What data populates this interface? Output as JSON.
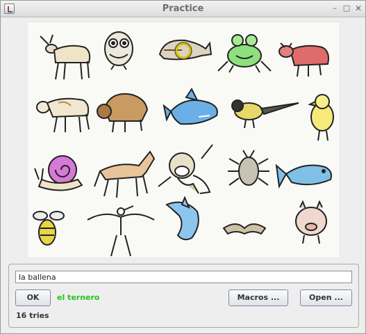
{
  "window": {
    "title": "Practice",
    "controls": {
      "minimize": "–",
      "maximize": "□",
      "close": "✕"
    }
  },
  "picture": {
    "items": [
      "goat",
      "owl",
      "whale",
      "frog",
      "bull",
      "calf",
      "bison",
      "shark",
      "bird",
      "chick",
      "snail",
      "horse",
      "monkey",
      "bug",
      "fish",
      "bee",
      "stork",
      "dolphin",
      "bat",
      "pig"
    ],
    "highlighted": "whale",
    "highlight_color": "#d4c400"
  },
  "answer": {
    "value": "la ballena"
  },
  "buttons": {
    "ok": "OK",
    "macros": "Macros ...",
    "open": "Open ..."
  },
  "feedback": {
    "text": "el ternero",
    "color": "#22c322"
  },
  "status": {
    "tries": "16 tries"
  }
}
